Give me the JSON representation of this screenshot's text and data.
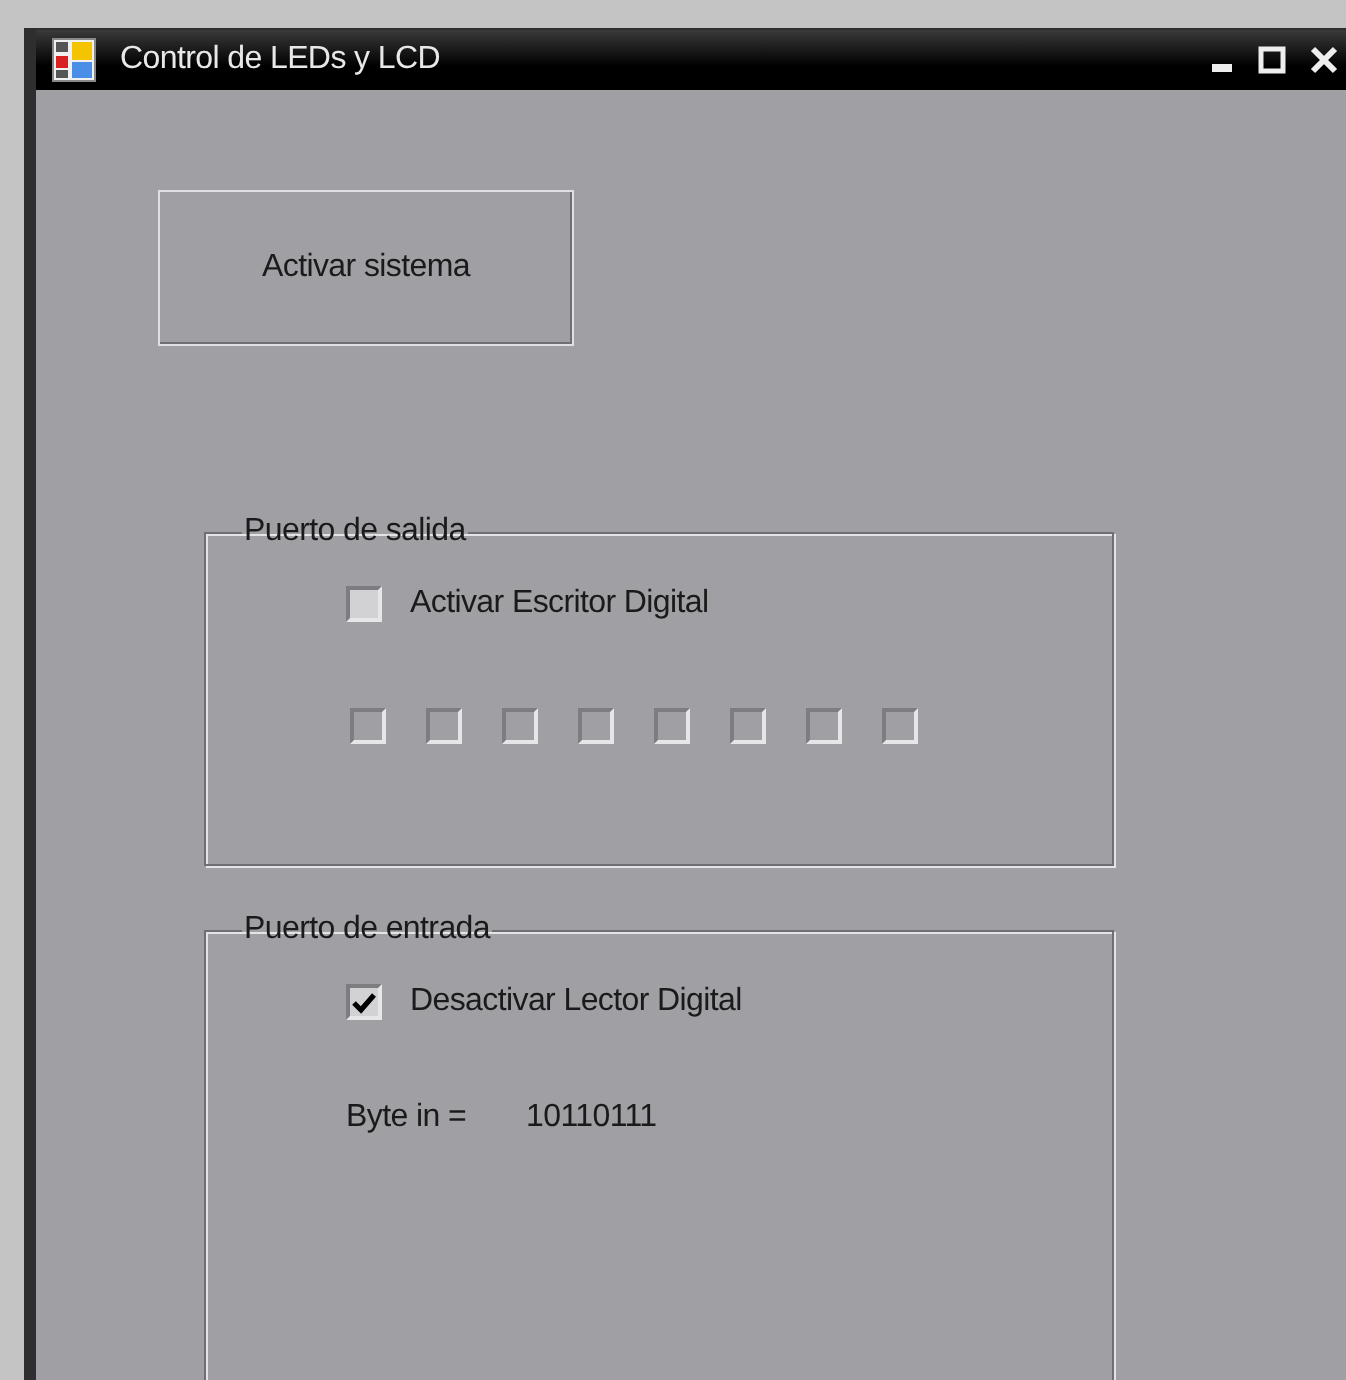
{
  "window": {
    "title": "Control de LEDs y LCD"
  },
  "button": {
    "label": "Activar sistema"
  },
  "output_port": {
    "title": "Puerto de salida",
    "toggle": {
      "label": "Activar Escritor Digital",
      "checked": false
    },
    "bits": [
      {
        "checked": false,
        "disabled": true
      },
      {
        "checked": false,
        "disabled": true
      },
      {
        "checked": false,
        "disabled": true
      },
      {
        "checked": false,
        "disabled": true
      },
      {
        "checked": false,
        "disabled": true
      },
      {
        "checked": false,
        "disabled": true
      },
      {
        "checked": false,
        "disabled": true
      },
      {
        "checked": false,
        "disabled": true
      }
    ]
  },
  "input_port": {
    "title": "Puerto de entrada",
    "toggle": {
      "label": "Desactivar Lector Digital",
      "checked": true
    },
    "byte_label": "Byte in =",
    "byte_value": "10110111"
  }
}
